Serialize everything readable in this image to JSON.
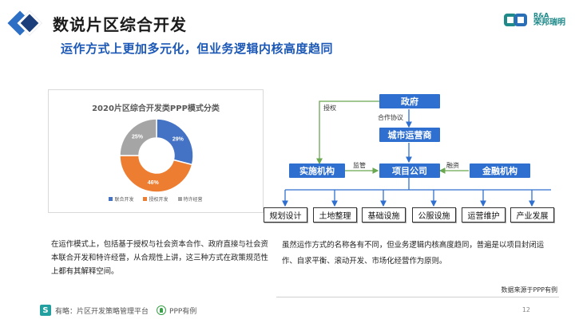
{
  "header": {
    "title": "数说片区综合开发",
    "subtitle": "运作方式上更加多元化，但业务逻辑内核高度趋同",
    "brand_top": "R&A",
    "brand_bottom": "荣邦瑞明"
  },
  "chart_data": {
    "type": "pie",
    "title": "2020片区综合开发类PPP模式分类",
    "categories": [
      "联合开发",
      "授权开发",
      "特许经营"
    ],
    "values": [
      29,
      46,
      25
    ],
    "labels": [
      "29%",
      "46%",
      "25%"
    ],
    "colors": [
      "#4472c4",
      "#ed7d31",
      "#a5a5a5"
    ],
    "donut": true,
    "legend_position": "bottom"
  },
  "flow": {
    "nodes": {
      "gov": "政府",
      "operator": "城市运营商",
      "impl": "实施机构",
      "project": "项目公司",
      "finance": "金融机构"
    },
    "edge_labels": {
      "authorize": "授权",
      "cooperate": "合作协议",
      "supervise": "监管",
      "financing": "融资"
    },
    "outputs": [
      "规划设计",
      "土地整理",
      "基础设施",
      "公服设施",
      "运营维护",
      "产业发展"
    ],
    "node_color": "#2f6fd0",
    "edge_color_green": "#6aa84f"
  },
  "text": {
    "left_paragraph": "在运作模式上，包括基于授权与社会资本合作、政府直接与社会资本联合开发和特许经营，从合规性上讲，这三种方式在政策规范性上都有其解释空间。",
    "right_paragraph": "虽然运作方式的名称各有不同，但业务逻辑内核高度趋同，普遍是以项目封闭运作、自求平衡、滚动开发、市场化经营作为原则。",
    "source": "数据来源于PPP有例"
  },
  "footer": {
    "s_icon": "S",
    "platform": "有略：片区开发策略管理平台",
    "ppp": "PPP有例",
    "page": "12"
  }
}
